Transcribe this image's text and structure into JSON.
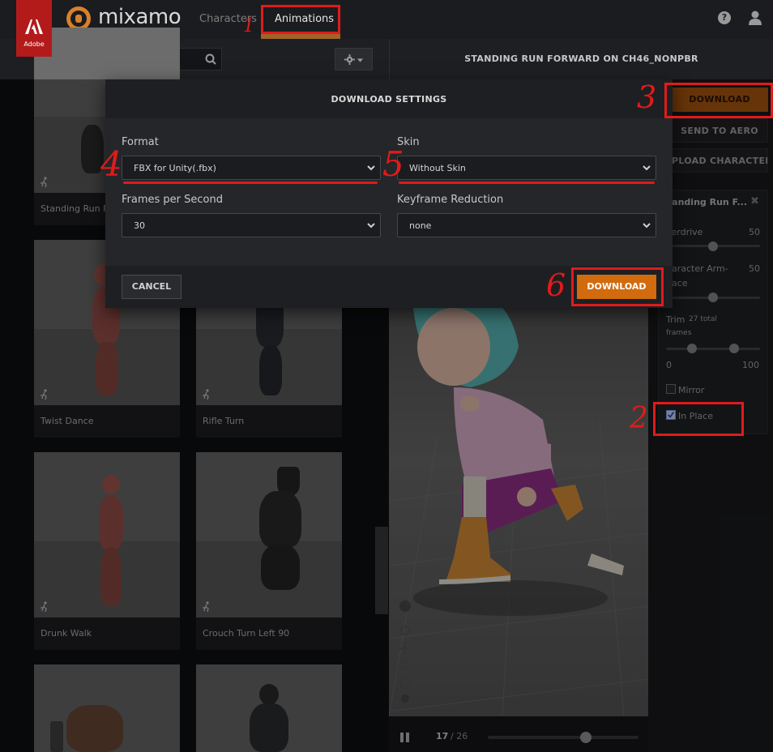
{
  "header": {
    "adobe_label": "Adobe",
    "brand": "mixamo",
    "tabs": [
      {
        "label": "Characters"
      },
      {
        "label": "Animations"
      }
    ]
  },
  "subbar": {
    "search_placeholder": "Search",
    "animation_title": "STANDING RUN FORWARD ON CH46_NONPBR"
  },
  "animation_cards": [
    {
      "label": "Standing Run F"
    },
    {
      "label": "Twist Dance"
    },
    {
      "label": "Rifle Turn"
    },
    {
      "label": "Drunk Walk"
    },
    {
      "label": "Crouch Turn Left 90"
    }
  ],
  "player": {
    "frame_current": "17",
    "frame_total": "/ 26",
    "progress_fraction": 0.65
  },
  "right_panel": {
    "download_label": "DOWNLOAD",
    "send_to_aero_label": "SEND TO AERO",
    "upload_character_label": "PLOAD CHARACTER",
    "settings": {
      "title": "Standing Run F...",
      "close_glyph": "✖",
      "overdrive_label": "verdrive",
      "overdrive_value": "50",
      "arm_space_label_1": "haracter Arm-",
      "arm_space_label_2": "pace",
      "arm_space_value": "50",
      "trim_label": "Trim",
      "trim_note_1": "27 total",
      "trim_note_2": "frames",
      "trim_min": "0",
      "trim_max": "100",
      "mirror_label": "Mirror",
      "mirror_checked": false,
      "in_place_label": "In Place",
      "in_place_checked": true
    }
  },
  "modal": {
    "title": "DOWNLOAD SETTINGS",
    "format_label": "Format",
    "format_value": "FBX for Unity(.fbx)",
    "skin_label": "Skin",
    "skin_value": "Without Skin",
    "fps_label": "Frames per Second",
    "fps_value": "30",
    "keyframe_label": "Keyframe Reduction",
    "keyframe_value": "none",
    "cancel_label": "CANCEL",
    "download_label": "DOWNLOAD"
  },
  "annotations": {
    "n1": "1",
    "n2": "2",
    "n3": "3",
    "n4": "4",
    "n5": "5",
    "n6": "6",
    "color": "#e01b1b"
  },
  "colors": {
    "accent": "#d26b0e",
    "brand_orange": "#d8812c",
    "adobe_red": "#b31b1b"
  }
}
